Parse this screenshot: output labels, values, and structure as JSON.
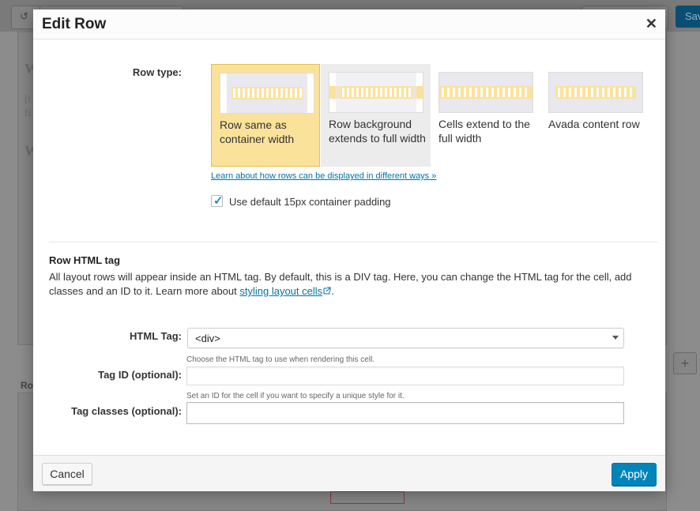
{
  "dialog": {
    "title": "Edit Row",
    "close_icon": "close-icon"
  },
  "row_type": {
    "label": "Row type:",
    "options": [
      {
        "label": "Row same as container width",
        "selected": true
      },
      {
        "label": "Row background extends to full width",
        "selected": false
      },
      {
        "label": "Cells extend to the full width",
        "selected": false
      },
      {
        "label": "Avada content row",
        "selected": false
      }
    ],
    "learn_link": "Learn about how rows can be displayed in different ways »",
    "padding_checkbox": {
      "label": "Use default 15px container padding",
      "checked": true
    }
  },
  "html_tag_section": {
    "title": "Row HTML tag",
    "description": "All layout rows will appear inside an HTML tag. By default, this is a DIV tag. Here, you can change the HTML tag for the cell, add classes and an ID to it. Learn more about",
    "link_text": "styling layout cells",
    "description_end": "."
  },
  "fields": {
    "html_tag": {
      "label": "HTML Tag:",
      "value": "<div>",
      "help": "Choose the HTML tag to use when rendering this cell."
    },
    "tag_id": {
      "label": "Tag ID (optional):",
      "value": "",
      "help": "Set an ID for the cell if you want to specify a unique style for it."
    },
    "tag_classes": {
      "label": "Tag classes (optional):",
      "value": ""
    }
  },
  "footer": {
    "cancel_label": "Cancel",
    "apply_label": "Apply"
  },
  "background": {
    "save_label": "Sav",
    "row_label": "Ro",
    "add_label": "+",
    "heading_letter": "W",
    "text_snippet": "[t",
    "text_snippet2": "fi",
    "heading_letter2": "W"
  },
  "colors": {
    "selected_bg": "#fbe29b",
    "accent": "#0085ba",
    "link": "#0073aa"
  }
}
